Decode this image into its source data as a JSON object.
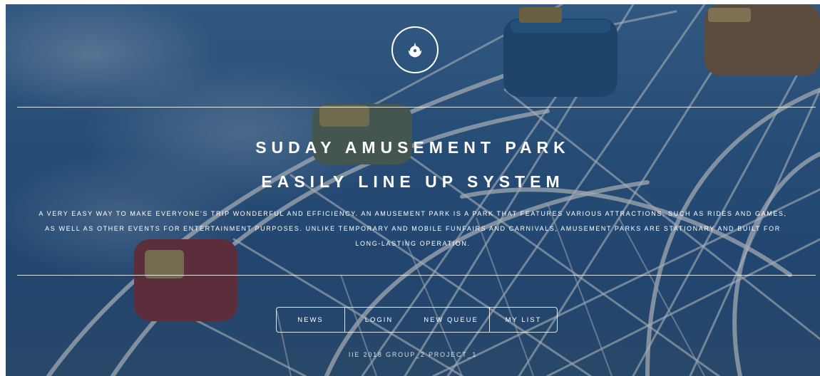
{
  "header": {
    "logo_icon": "rebel-alliance-icon",
    "title_line1": "SUDAY AMUSEMENT PARK",
    "title_line2": "EASILY LINE UP SYSTEM"
  },
  "intro": {
    "text": "A VERY EASY WAY TO MAKE EVERYONE'S TRIP WONDERFUL AND EFFICIENCY. AN AMUSEMENT PARK IS A PARK THAT FEATURES VARIOUS ATTRACTIONS, SUCH AS RIDES AND GAMES, AS WELL AS OTHER EVENTS FOR ENTERTAINMENT PURPOSES. UNLIKE TEMPORARY AND MOBILE FUNFAIRS AND CARNIVALS, AMUSEMENT PARKS ARE STATIONARY AND BUILT FOR LONG-LASTING OPERATION."
  },
  "nav": {
    "items": [
      {
        "label": "NEWS"
      },
      {
        "label": "LOGIN"
      },
      {
        "label": "NEW QUEUE"
      },
      {
        "label": "MY LIST"
      }
    ]
  },
  "footer": {
    "text": "IIE 2018 GROUP_2 PROJECT_1"
  },
  "colors": {
    "sky": "#2f5f90",
    "text": "#ffffff"
  }
}
